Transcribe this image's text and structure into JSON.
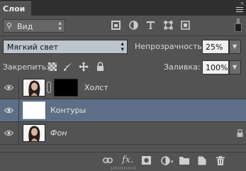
{
  "panel": {
    "title": "Слои"
  },
  "filter": {
    "kind_label": "Вид",
    "icons": [
      "image-filter-icon",
      "adjustment-filter-icon",
      "type-filter-icon",
      "shape-filter-icon",
      "smart-object-filter-icon"
    ]
  },
  "blend": {
    "mode": "Мягкий свет",
    "opacity_label": "Непрозрачность:",
    "opacity_value": "25%",
    "lock_label": "Закрепить:",
    "fill_label": "Заливка:",
    "fill_value": "100%"
  },
  "layers": [
    {
      "name": "Холст",
      "visible": true,
      "selected": false,
      "has_mask": true,
      "locked": false,
      "italic": false
    },
    {
      "name": "Контуры",
      "visible": true,
      "selected": true,
      "has_mask": false,
      "locked": false,
      "italic": false
    },
    {
      "name": "Фон",
      "visible": true,
      "selected": false,
      "has_mask": false,
      "locked": true,
      "italic": true
    }
  ],
  "bottom": {
    "fx_label": "fx."
  },
  "colors": {
    "panel_bg": "#535353",
    "selected_row": "#5c6f86",
    "blend_field": "#bcc4cd"
  }
}
